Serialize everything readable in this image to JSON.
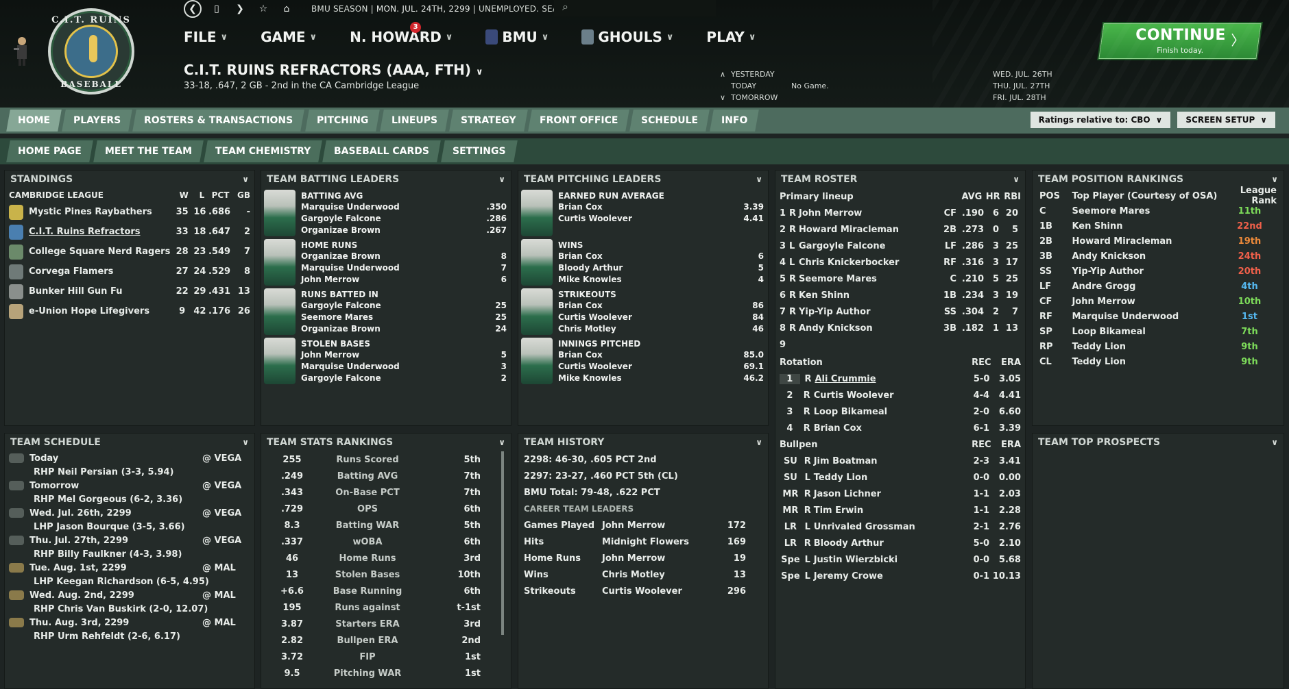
{
  "topbar": {
    "season": "BMU SEASON",
    "sep1": "|",
    "date": "MON. JUL. 24TH, 2299",
    "sep2": "|",
    "status": "UNEMPLOYED. SEARCH JOBS..."
  },
  "menu": {
    "file": "FILE",
    "game": "GAME",
    "manager": "N. HOWARD",
    "manager_badge": "3",
    "league": "BMU",
    "team": "GHOULS",
    "play": "PLAY",
    "chev": "∨"
  },
  "logo": {
    "top": "C.I.T. RUINS",
    "bottom": "BASEBALL"
  },
  "team": {
    "title": "C.I.T. RUINS REFRACTORS (AAA, FTH)",
    "subtitle": "33-18, .647, 2 GB - 2nd in the CA Cambridge League"
  },
  "days": {
    "yesterday": "YESTERDAY",
    "today": "TODAY",
    "today_value": "No Game.",
    "tomorrow": "TOMORROW",
    "up": "∧",
    "down": "∨"
  },
  "next_days": [
    "WED. JUL. 26TH",
    "THU. JUL. 27TH",
    "FRI. JUL. 28TH"
  ],
  "continue": {
    "label": "CONTINUE",
    "sub": "Finish today.",
    "arrow": "〉"
  },
  "tabs1": [
    "HOME",
    "PLAYERS",
    "ROSTERS & TRANSACTIONS",
    "PITCHING",
    "LINEUPS",
    "STRATEGY",
    "FRONT OFFICE",
    "SCHEDULE",
    "INFO"
  ],
  "ratings_button": "Ratings relative to: CBO",
  "screen_setup": "SCREEN SETUP",
  "tabs2": [
    "HOME PAGE",
    "MEET THE TEAM",
    "TEAM CHEMISTRY",
    "BASEBALL CARDS",
    "SETTINGS"
  ],
  "standings": {
    "title": "STANDINGS",
    "league": "CAMBRIDGE LEAGUE",
    "cols": [
      "W",
      "L",
      "PCT",
      "GB"
    ],
    "rows": [
      {
        "team": "Mystic Pines Raybathers",
        "w": "35",
        "l": "16",
        "pct": ".686",
        "gb": "-",
        "color": "#c9b34a"
      },
      {
        "team": "C.I.T. Ruins Refractors",
        "w": "33",
        "l": "18",
        "pct": ".647",
        "gb": "2",
        "color": "#4a7fb0"
      },
      {
        "team": "College Square Nerd Ragers",
        "w": "28",
        "l": "23",
        "pct": ".549",
        "gb": "7",
        "color": "#6b8a6a"
      },
      {
        "team": "Corvega Flamers",
        "w": "27",
        "l": "24",
        "pct": ".529",
        "gb": "8",
        "color": "#6f7a78"
      },
      {
        "team": "Bunker Hill Gun Fu",
        "w": "22",
        "l": "29",
        "pct": ".431",
        "gb": "13",
        "color": "#8a8f8c"
      },
      {
        "team": "e-Union Hope Lifegivers",
        "w": "9",
        "l": "42",
        "pct": ".176",
        "gb": "26",
        "color": "#b7a37a"
      }
    ]
  },
  "batting": {
    "title": "TEAM BATTING LEADERS",
    "blocks": [
      {
        "stat": "BATTING AVG",
        "players": [
          "Marquise Underwood",
          "Gargoyle Falcone",
          "Organizae Brown"
        ],
        "values": [
          ".350",
          ".286",
          ".267"
        ]
      },
      {
        "stat": "HOME RUNS",
        "players": [
          "Organizae Brown",
          "Marquise Underwood",
          "John Merrow"
        ],
        "values": [
          "8",
          "7",
          "6"
        ]
      },
      {
        "stat": "RUNS BATTED IN",
        "players": [
          "Gargoyle Falcone",
          "Seemore Mares",
          "Organizae Brown"
        ],
        "values": [
          "25",
          "25",
          "24"
        ]
      },
      {
        "stat": "STOLEN BASES",
        "players": [
          "John Merrow",
          "Marquise Underwood",
          "Gargoyle Falcone"
        ],
        "values": [
          "5",
          "3",
          "2"
        ]
      }
    ]
  },
  "pitching": {
    "title": "TEAM PITCHING LEADERS",
    "blocks": [
      {
        "stat": "EARNED RUN AVERAGE",
        "players": [
          "Brian Cox",
          "Curtis Woolever",
          ""
        ],
        "values": [
          "3.39",
          "4.41",
          ""
        ]
      },
      {
        "stat": "WINS",
        "players": [
          "Brian Cox",
          "Bloody Arthur",
          "Mike Knowles"
        ],
        "values": [
          "6",
          "5",
          "4"
        ]
      },
      {
        "stat": "STRIKEOUTS",
        "players": [
          "Brian Cox",
          "Curtis Woolever",
          "Chris Motley"
        ],
        "values": [
          "86",
          "84",
          "46"
        ]
      },
      {
        "stat": "INNINGS PITCHED",
        "players": [
          "Brian Cox",
          "Curtis Woolever",
          "Mike Knowles"
        ],
        "values": [
          "85.0",
          "69.1",
          "46.2"
        ]
      }
    ]
  },
  "roster": {
    "title": "TEAM ROSTER",
    "lineup_label": "Primary lineup",
    "lineup_cols": [
      "AVG",
      "HR",
      "RBI"
    ],
    "lineup": [
      {
        "n": "1",
        "h": "R",
        "name": "John Merrow",
        "pos": "CF",
        "avg": ".190",
        "hr": "6",
        "rbi": "20"
      },
      {
        "n": "2",
        "h": "R",
        "name": "Howard Miracleman",
        "pos": "2B",
        "avg": ".273",
        "hr": "0",
        "rbi": "5"
      },
      {
        "n": "3",
        "h": "L",
        "name": "Gargoyle Falcone",
        "pos": "LF",
        "avg": ".286",
        "hr": "3",
        "rbi": "25"
      },
      {
        "n": "4",
        "h": "L",
        "name": "Chris Knickerbocker",
        "pos": "RF",
        "avg": ".316",
        "hr": "3",
        "rbi": "17"
      },
      {
        "n": "5",
        "h": "R",
        "name": "Seemore Mares",
        "pos": "C",
        "avg": ".210",
        "hr": "5",
        "rbi": "25"
      },
      {
        "n": "6",
        "h": "R",
        "name": "Ken Shinn",
        "pos": "1B",
        "avg": ".234",
        "hr": "3",
        "rbi": "19"
      },
      {
        "n": "7",
        "h": "R",
        "name": "Yip-Yip Author",
        "pos": "SS",
        "avg": ".304",
        "hr": "2",
        "rbi": "7"
      },
      {
        "n": "8",
        "h": "R",
        "name": "Andy Knickson",
        "pos": "3B",
        "avg": ".182",
        "hr": "1",
        "rbi": "13"
      },
      {
        "n": "9",
        "h": "",
        "name": "",
        "pos": "",
        "avg": "",
        "hr": "",
        "rbi": ""
      }
    ],
    "rotation_label": "Rotation",
    "rotation_cols": [
      "REC",
      "ERA"
    ],
    "rotation": [
      {
        "n": "1",
        "h": "R",
        "name": "Ali Crummie",
        "rec": "5-0",
        "era": "3.05"
      },
      {
        "n": "2",
        "h": "R",
        "name": "Curtis Woolever",
        "rec": "4-4",
        "era": "4.41"
      },
      {
        "n": "3",
        "h": "R",
        "name": "Loop Bikameal",
        "rec": "2-0",
        "era": "6.60"
      },
      {
        "n": "4",
        "h": "R",
        "name": "Brian Cox",
        "rec": "6-1",
        "era": "3.39"
      }
    ],
    "bullpen_label": "Bullpen",
    "bullpen": [
      {
        "role": "SU",
        "h": "R",
        "name": "Jim Boatman",
        "rec": "2-3",
        "era": "3.41"
      },
      {
        "role": "SU",
        "h": "L",
        "name": "Teddy Lion",
        "rec": "0-0",
        "era": "0.00"
      },
      {
        "role": "MR",
        "h": "R",
        "name": "Jason Lichner",
        "rec": "1-1",
        "era": "2.03"
      },
      {
        "role": "MR",
        "h": "R",
        "name": "Tim Erwin",
        "rec": "1-1",
        "era": "2.28"
      },
      {
        "role": "LR",
        "h": "L",
        "name": "Unrivaled Grossman",
        "rec": "2-1",
        "era": "2.76"
      },
      {
        "role": "LR",
        "h": "R",
        "name": "Bloody Arthur",
        "rec": "5-0",
        "era": "2.10"
      },
      {
        "role": "Spe",
        "h": "L",
        "name": "Justin Wierzbicki",
        "rec": "0-0",
        "era": "5.68"
      },
      {
        "role": "Spe",
        "h": "L",
        "name": "Jeremy Crowe",
        "rec": "0-1",
        "era": "10.13"
      }
    ]
  },
  "positions": {
    "title": "TEAM POSITION RANKINGS",
    "cols": [
      "POS",
      "Top Player (Courtesy of OSA)",
      "League Rank"
    ],
    "rows": [
      {
        "pos": "C",
        "player": "Seemore Mares",
        "rank": "11th",
        "color": "#7ddc5a"
      },
      {
        "pos": "1B",
        "player": "Ken Shinn",
        "rank": "22nd",
        "color": "#f0604a"
      },
      {
        "pos": "2B",
        "player": "Howard Miracleman",
        "rank": "19th",
        "color": "#ee8a3a"
      },
      {
        "pos": "3B",
        "player": "Andy Knickson",
        "rank": "24th",
        "color": "#f0604a"
      },
      {
        "pos": "SS",
        "player": "Yip-Yip Author",
        "rank": "20th",
        "color": "#f0604a"
      },
      {
        "pos": "LF",
        "player": "Andre Grogg",
        "rank": "4th",
        "color": "#55b8f0"
      },
      {
        "pos": "CF",
        "player": "John Merrow",
        "rank": "10th",
        "color": "#7ddc5a"
      },
      {
        "pos": "RF",
        "player": "Marquise Underwood",
        "rank": "1st",
        "color": "#55b8f0"
      },
      {
        "pos": "SP",
        "player": "Loop Bikameal",
        "rank": "7th",
        "color": "#7ddc5a"
      },
      {
        "pos": "RP",
        "player": "Teddy Lion",
        "rank": "9th",
        "color": "#7ddc5a"
      },
      {
        "pos": "CL",
        "player": "Teddy Lion",
        "rank": "9th",
        "color": "#7ddc5a"
      }
    ]
  },
  "schedule": {
    "title": "TEAM SCHEDULE",
    "rows": [
      {
        "day": "Today",
        "opp": "@ VEGA",
        "sp": "RHP Neil Persian (3-3, 5.94)"
      },
      {
        "day": "Tomorrow",
        "opp": "@ VEGA",
        "sp": "RHP Mel Gorgeous (6-2, 3.36)"
      },
      {
        "day": "Wed. Jul. 26th, 2299",
        "opp": "@ VEGA",
        "sp": "LHP Jason Bourque (3-5, 3.66)"
      },
      {
        "day": "Thu. Jul. 27th, 2299",
        "opp": "@ VEGA",
        "sp": "RHP Billy Faulkner (4-3, 3.98)"
      },
      {
        "day": "Tue. Aug. 1st, 2299",
        "opp": "@ MAL",
        "sp": "LHP Keegan Richardson (6-5, 4.95)"
      },
      {
        "day": "Wed. Aug. 2nd, 2299",
        "opp": "@ MAL",
        "sp": "RHP Chris Van Buskirk (2-0, 12.07)"
      },
      {
        "day": "Thu. Aug. 3rd, 2299",
        "opp": "@ MAL",
        "sp": "RHP Urm Rehfeldt (2-6, 6.17)"
      }
    ]
  },
  "stats": {
    "title": "TEAM STATS RANKINGS",
    "rows": [
      {
        "v": "255",
        "stat": "Runs Scored",
        "rank": "5th"
      },
      {
        "v": ".249",
        "stat": "Batting AVG",
        "rank": "7th"
      },
      {
        "v": ".343",
        "stat": "On-Base PCT",
        "rank": "7th"
      },
      {
        "v": ".729",
        "stat": "OPS",
        "rank": "6th"
      },
      {
        "v": "8.3",
        "stat": "Batting WAR",
        "rank": "5th"
      },
      {
        "v": ".337",
        "stat": "wOBA",
        "rank": "6th"
      },
      {
        "v": "46",
        "stat": "Home Runs",
        "rank": "3rd"
      },
      {
        "v": "13",
        "stat": "Stolen Bases",
        "rank": "10th"
      },
      {
        "v": "+6.6",
        "stat": "Base Running",
        "rank": "6th"
      },
      {
        "v": "195",
        "stat": "Runs against",
        "rank": "t-1st"
      },
      {
        "v": "3.87",
        "stat": "Starters ERA",
        "rank": "3rd"
      },
      {
        "v": "2.82",
        "stat": "Bullpen ERA",
        "rank": "2nd"
      },
      {
        "v": "3.72",
        "stat": "FIP",
        "rank": "1st"
      },
      {
        "v": "9.5",
        "stat": "Pitching WAR",
        "rank": "1st"
      }
    ]
  },
  "history": {
    "title": "TEAM HISTORY",
    "lines": [
      "2298: 46-30, .605 PCT 2nd",
      "2297: 23-27, .460 PCT 5th (CL)",
      "BMU Total: 79-48, .622 PCT"
    ],
    "career_label": "CAREER TEAM LEADERS",
    "career": [
      {
        "stat": "Games Played",
        "player": "John Merrow",
        "v": "172"
      },
      {
        "stat": "Hits",
        "player": "Midnight Flowers",
        "v": "169"
      },
      {
        "stat": "Home Runs",
        "player": "John Merrow",
        "v": "19"
      },
      {
        "stat": "Wins",
        "player": "Chris Motley",
        "v": "13"
      },
      {
        "stat": "Strikeouts",
        "player": "Curtis Woolever",
        "v": "296"
      }
    ]
  },
  "prospects": {
    "title": "TEAM TOP PROSPECTS"
  },
  "chev": "∨"
}
